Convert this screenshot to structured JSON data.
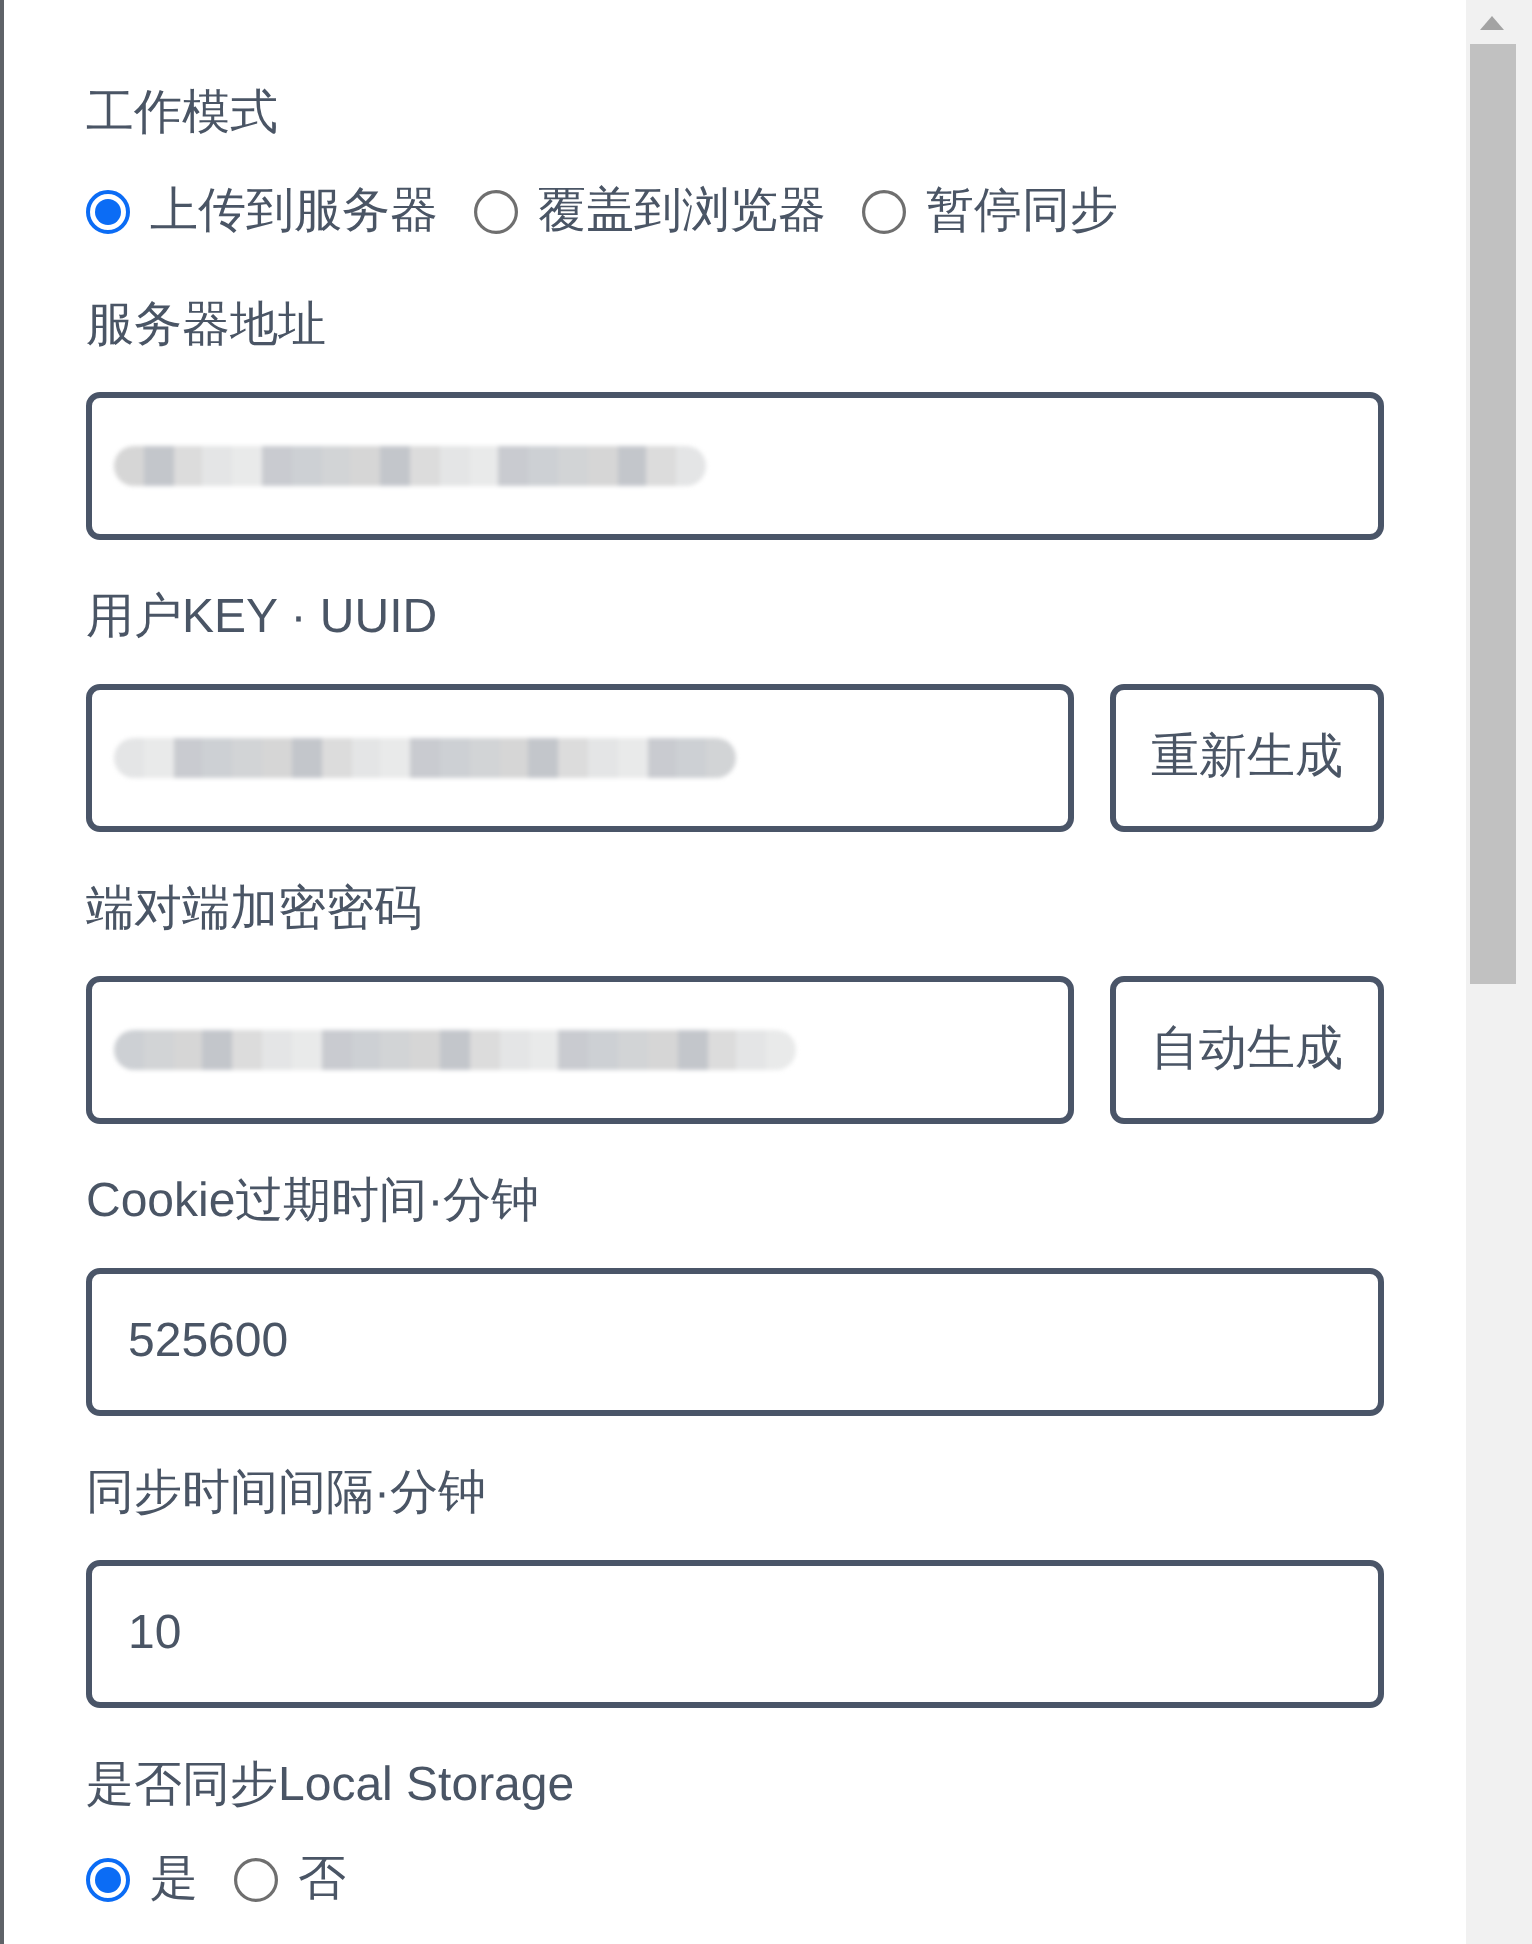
{
  "mode": {
    "label": "工作模式",
    "options": [
      {
        "label": "上传到服务器",
        "selected": true
      },
      {
        "label": "覆盖到浏览器",
        "selected": false
      },
      {
        "label": "暂停同步",
        "selected": false
      }
    ]
  },
  "fields": [
    {
      "kind": "text",
      "label": "服务器地址",
      "redacted": true
    },
    {
      "kind": "text_button",
      "label": "用户KEY · UUID",
      "redacted": true,
      "button": "重新生成"
    },
    {
      "kind": "text_button",
      "label": "端对端加密密码",
      "redacted": true,
      "button": "自动生成"
    },
    {
      "kind": "text",
      "label": "Cookie过期时间·分钟",
      "redacted": false,
      "value": "525600"
    },
    {
      "kind": "text",
      "label": "同步时间间隔·分钟",
      "redacted": false,
      "value": "10"
    }
  ],
  "local_storage": {
    "label": "是否同步Local Storage",
    "options": [
      {
        "label": "是",
        "selected": true
      },
      {
        "label": "否",
        "selected": false
      }
    ]
  }
}
